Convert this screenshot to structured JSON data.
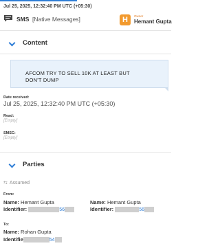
{
  "header": {
    "timestamp": "Jul 25, 2025, 12:32:40 PM UTC (+05:30)",
    "type_label": "SMS",
    "type_sub": "[Native Messages]",
    "owner_badge_letter": "H",
    "owner_caption": "Owner",
    "owner_name": "Hemant Gupta"
  },
  "content_section": {
    "title": "Content",
    "message_line1": "AFCOM TRY TO SELL 10K AT LEAST BUT",
    "message_line2": "DON'T DUMP"
  },
  "fields": {
    "date_received_label": "Date received:",
    "date_received_value": "Jul 25, 2025, 12:32:40 PM UTC (+05:30)",
    "read_label": "Read:",
    "read_value": "[Empty]",
    "smsc_label": "SMSC:",
    "smsc_value": "[Empty]"
  },
  "parties_section": {
    "title": "Parties",
    "assumed_label": "Assumed",
    "from_label": "From:",
    "from": [
      {
        "name_label": "Name:",
        "name": "Hemant Gupta",
        "identifier_label": "Identifier:",
        "identifier_visible": "56"
      },
      {
        "name_label": "Name:",
        "name": "Hemant Gupta",
        "identifier_label": "Identifier:",
        "identifier_visible": "56"
      }
    ],
    "to_label": "To:",
    "to": [
      {
        "name_label": "Name:",
        "name": "Rohan Gupta",
        "identifier_label": "Identifie",
        "identifier_visible": "54"
      }
    ]
  },
  "colors": {
    "accent": "#2e7dd6",
    "owner_badge": "#f29a2e",
    "bubble_bg": "#e9f2fb"
  }
}
